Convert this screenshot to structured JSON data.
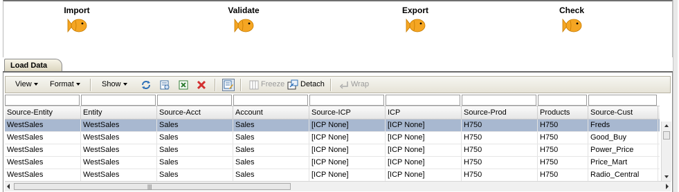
{
  "workflow": {
    "steps": [
      {
        "label": "Import",
        "icon": "fish-icon"
      },
      {
        "label": "Validate",
        "icon": "fish-icon"
      },
      {
        "label": "Export",
        "icon": "fish-icon"
      },
      {
        "label": "Check",
        "icon": "fish-icon"
      }
    ],
    "fish_color": "#f5a623"
  },
  "tab": {
    "label": "Load Data"
  },
  "toolbar": {
    "view": "View",
    "format": "Format",
    "show": "Show",
    "freeze": "Freeze",
    "detach": "Detach",
    "wrap": "Wrap"
  },
  "grid": {
    "columns": [
      "Source-Entity",
      "Entity",
      "Source-Acct",
      "Account",
      "Source-ICP",
      "ICP",
      "Source-Prod",
      "Products",
      "Source-Cust"
    ],
    "rows": [
      [
        "WestSales",
        "WestSales",
        "Sales",
        "Sales",
        "[ICP None]",
        "[ICP None]",
        "H750",
        "H750",
        "Freds"
      ],
      [
        "WestSales",
        "WestSales",
        "Sales",
        "Sales",
        "[ICP None]",
        "[ICP None]",
        "H750",
        "H750",
        "Good_Buy"
      ],
      [
        "WestSales",
        "WestSales",
        "Sales",
        "Sales",
        "[ICP None]",
        "[ICP None]",
        "H750",
        "H750",
        "Power_Price"
      ],
      [
        "WestSales",
        "WestSales",
        "Sales",
        "Sales",
        "[ICP None]",
        "[ICP None]",
        "H750",
        "H750",
        "Price_Mart"
      ],
      [
        "WestSales",
        "WestSales",
        "Sales",
        "Sales",
        "[ICP None]",
        "[ICP None]",
        "H750",
        "H750",
        "Radio_Central"
      ]
    ],
    "selected_row": 0,
    "selection_color": "#a8b8d0"
  }
}
